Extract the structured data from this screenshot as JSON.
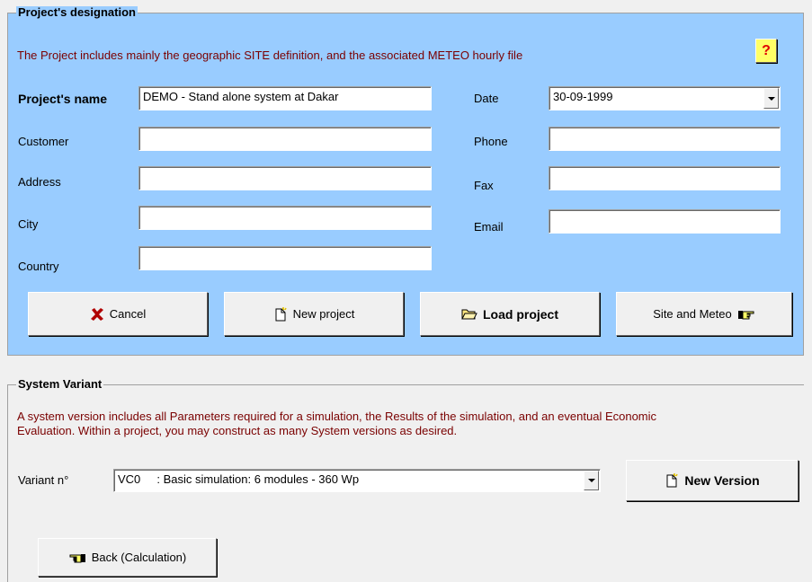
{
  "project": {
    "legend": "Project's designation",
    "description": "The Project includes mainly the geographic SITE definition, and the associated  METEO  hourly file",
    "help_label": "?",
    "fields": {
      "name_label": "Project's name",
      "name_value": "DEMO - Stand alone system at Dakar",
      "customer_label": "Customer",
      "customer_value": "",
      "address_label": "Address",
      "address_value": "",
      "city_label": "City",
      "city_value": "",
      "country_label": "Country",
      "country_value": "",
      "date_label": "Date",
      "date_value": "30-09-1999",
      "phone_label": "Phone",
      "phone_value": "",
      "fax_label": "Fax",
      "fax_value": "",
      "email_label": "Email",
      "email_value": ""
    },
    "buttons": {
      "cancel": "Cancel",
      "new_project": "New project",
      "load_project": "Load project",
      "site_meteo": "Site and Meteo"
    }
  },
  "variant": {
    "legend": "System Variant",
    "description_line1": "A system version includes all Parameters required for a simulation, the Results of the simulation, and an eventual Economic",
    "description_line2": "Evaluation.  Within a project, you may construct as many System versions as desired.",
    "variant_label": "Variant n°",
    "variant_value": "VC0     : Basic simulation: 6 modules - 360 Wp",
    "new_version": "New Version"
  },
  "footer": {
    "back_button": "Back (Calculation)"
  },
  "colors": {
    "panel_blue": "#99ccff",
    "description_red": "#7a0000",
    "help_yellow": "#ffff66",
    "cancel_x": "#b00000"
  },
  "icons": [
    "help-icon",
    "cancel-x-icon",
    "new-document-icon",
    "open-folder-icon",
    "pointing-hand-icon",
    "back-hand-icon"
  ]
}
